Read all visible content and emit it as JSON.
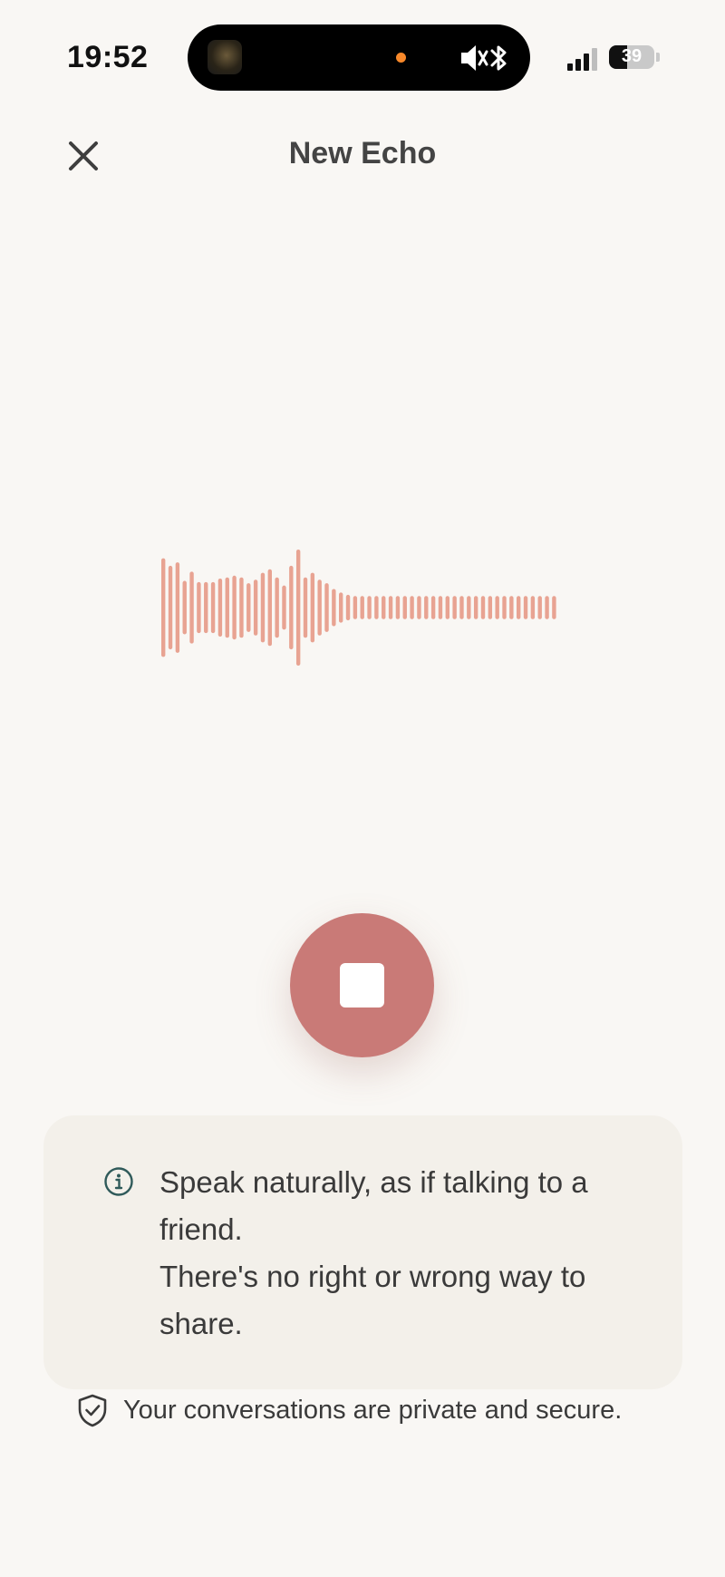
{
  "status_bar": {
    "time": "19:52",
    "battery_level": "39",
    "battery_percent": 39,
    "signal_bars_active": 3,
    "signal_bars_total": 4,
    "recording_dot_color": "#f7882a"
  },
  "header": {
    "title": "New Echo",
    "close_icon": "close-icon"
  },
  "recorder": {
    "waveform_color": "#e8a392",
    "waveform_levels": [
      0.85,
      0.72,
      0.78,
      0.46,
      0.62,
      0.44,
      0.44,
      0.44,
      0.5,
      0.52,
      0.55,
      0.52,
      0.42,
      0.48,
      0.6,
      0.66,
      0.52,
      0.38,
      0.72,
      1.0,
      0.52,
      0.6,
      0.48,
      0.42,
      0.32,
      0.26,
      0.22,
      0.2,
      0.2,
      0.2,
      0.2,
      0.2,
      0.2,
      0.2,
      0.2,
      0.2,
      0.2,
      0.2,
      0.2,
      0.2,
      0.2,
      0.2,
      0.2,
      0.2,
      0.2,
      0.2,
      0.2,
      0.2,
      0.2,
      0.2,
      0.2,
      0.2,
      0.2,
      0.2,
      0.2,
      0.2
    ],
    "stop_button_color": "#c97a77",
    "stop_icon": "stop-icon"
  },
  "info": {
    "icon": "info-icon",
    "line1": "Speak naturally, as if talking to a friend.",
    "line2": "There's no right or wrong way to share."
  },
  "privacy": {
    "icon": "shield-check-icon",
    "text": "Your conversations are private and secure."
  }
}
